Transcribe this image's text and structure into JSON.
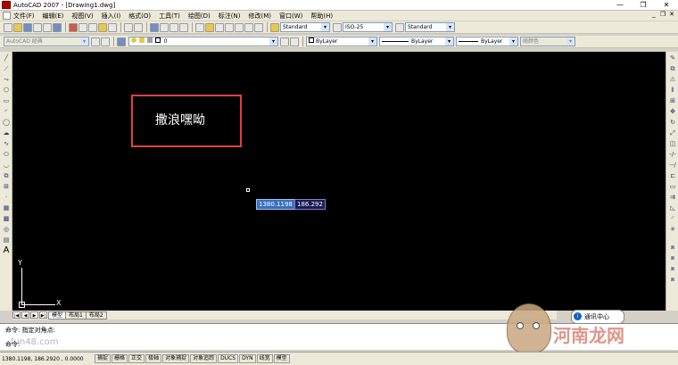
{
  "window": {
    "title": "AutoCAD 2007 - [Drawing1.dwg]",
    "minimize": "—",
    "restore": "❐",
    "close": "✕"
  },
  "menu": {
    "items": [
      "文件(F)",
      "编辑(E)",
      "视图(V)",
      "插入(I)",
      "格式(O)",
      "工具(T)",
      "绘图(D)",
      "标注(N)",
      "修改(M)",
      "窗口(W)",
      "帮助(H)"
    ],
    "mdi_minimize": "_",
    "mdi_restore": "❐",
    "mdi_close": "✕"
  },
  "styles_toolbar": {
    "text_style": "Standard",
    "dim_style": "ISO-25",
    "table_style": "Standard"
  },
  "workspace_toolbar": {
    "workspace": "AutoCAD 经典"
  },
  "layer_toolbar": {
    "layer": "0"
  },
  "properties_toolbar": {
    "color": "ByLayer",
    "linetype": "ByLayer",
    "lineweight": "ByLayer",
    "plotstyle": "随颜色"
  },
  "canvas": {
    "text": "撒浪嘿呦",
    "coord_x": "1380.1198",
    "coord_y": "186.292",
    "ucs_x": "X",
    "ucs_y": "Y"
  },
  "tabs": {
    "nav": [
      "|◀",
      "◀",
      "▶",
      "▶|"
    ],
    "items": [
      "模型",
      "布局1",
      "布局2"
    ]
  },
  "command": {
    "line1": "命令: 指定对角点:",
    "line2": "命令:"
  },
  "status": {
    "coords": "1380.1198, 186.2920 , 0.0000",
    "buttons": [
      "捕捉",
      "栅格",
      "正交",
      "极轴",
      "对象捕捉",
      "对象追踪",
      "DUCS",
      "DYN",
      "线宽",
      "模型"
    ]
  },
  "comm_center": {
    "label": "通讯中心"
  },
  "watermarks": {
    "left": "fun48.com",
    "right": "河南龙网"
  },
  "colors": {
    "canvas_bg": "#000000",
    "rect_outline": "#e04040",
    "coord_x_bg": "#3a6fbf",
    "coord_y_bg": "#1b1b55"
  }
}
